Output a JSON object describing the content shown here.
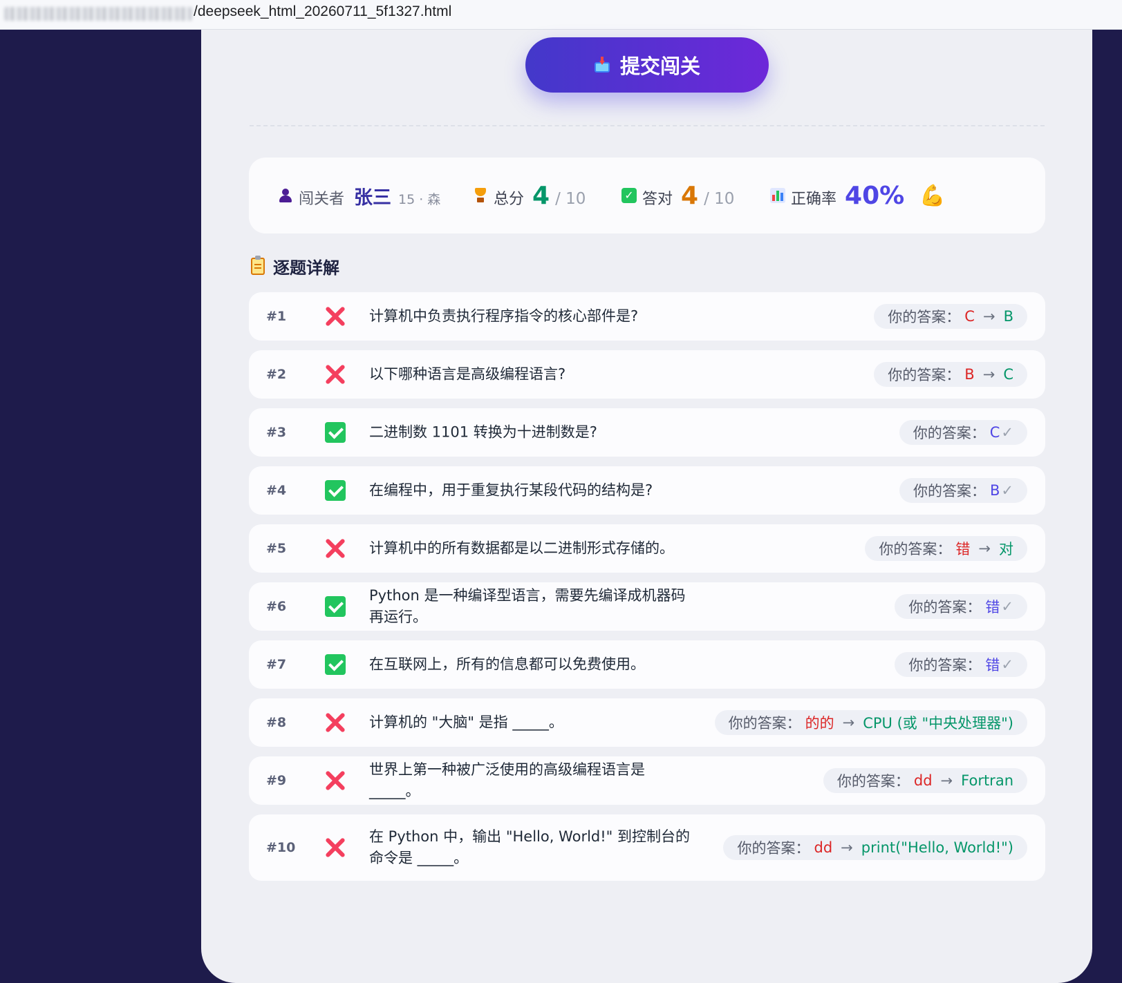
{
  "browser": {
    "url_visible": "/deepseek_html_20260711_5f1327.html"
  },
  "submit": {
    "label": "提交闯关",
    "icon": "inbox-tray-icon"
  },
  "stats": {
    "player_label": "闯关者",
    "player_name": "张三",
    "player_meta": "15 · 森",
    "score_label": "总分",
    "score_value": "4",
    "score_total": "/ 10",
    "correct_label": "答对",
    "correct_value": "4",
    "correct_total": "/ 10",
    "rate_label": "正确率",
    "rate_value": "40%",
    "rate_emoji": "💪"
  },
  "details": {
    "title": "逐题详解",
    "answer_label": "你的答案：",
    "arrow": "→",
    "tick": "✓"
  },
  "questions": [
    {
      "num": "#1",
      "status": "wrong",
      "text": "计算机中负责执行程序指令的核心部件是?",
      "your_answer": "C",
      "correct_answer": "B"
    },
    {
      "num": "#2",
      "status": "wrong",
      "text": "以下哪种语言是高级编程语言?",
      "your_answer": "B",
      "correct_answer": "C"
    },
    {
      "num": "#3",
      "status": "correct",
      "text": "二进制数 1101 转换为十进制数是?",
      "your_answer": "C"
    },
    {
      "num": "#4",
      "status": "correct",
      "text": "在编程中，用于重复执行某段代码的结构是?",
      "your_answer": "B"
    },
    {
      "num": "#5",
      "status": "wrong",
      "text": "计算机中的所有数据都是以二进制形式存储的。",
      "your_answer": "错",
      "correct_answer": "对"
    },
    {
      "num": "#6",
      "status": "correct",
      "text": "Python 是一种编译型语言，需要先编译成机器码再运行。",
      "your_answer": "错"
    },
    {
      "num": "#7",
      "status": "correct",
      "text": "在互联网上，所有的信息都可以免费使用。",
      "your_answer": "错"
    },
    {
      "num": "#8",
      "status": "wrong",
      "text": "计算机的 \"大脑\" 是指 _____。",
      "your_answer": "的的",
      "correct_answer": "CPU (或 \"中央处理器\")"
    },
    {
      "num": "#9",
      "status": "wrong",
      "text": "世界上第一种被广泛使用的高级编程语言是 _____。",
      "your_answer": "dd",
      "correct_answer": "Fortran"
    },
    {
      "num": "#10",
      "status": "wrong",
      "text": "在 Python 中，输出 \"Hello, World!\" 到控制台的命令是 _____。",
      "your_answer": "dd",
      "correct_answer": "print(\"Hello, World!\")"
    }
  ],
  "colors": {
    "background": "#1e1b4b",
    "accent": "#4f46e5",
    "wrong": "#dc2626",
    "correct": "#059669"
  }
}
